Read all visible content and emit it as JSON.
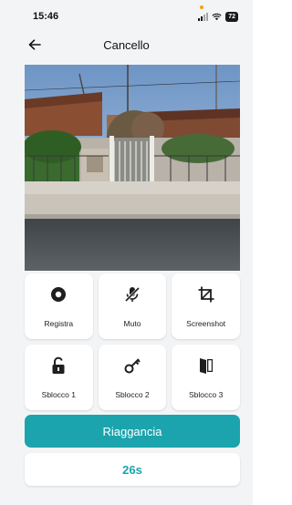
{
  "status_bar": {
    "time": "15:46",
    "battery": "72"
  },
  "nav": {
    "title": "Cancello",
    "back_icon": "arrow-left-icon"
  },
  "video": {
    "description_icon": "camera-feed"
  },
  "actions": [
    {
      "label": "Registra",
      "icon": "record-icon"
    },
    {
      "label": "Muto",
      "icon": "mute-icon"
    },
    {
      "label": "Screenshot",
      "icon": "crop-icon"
    },
    {
      "label": "Sblocco 1",
      "icon": "unlock-icon"
    },
    {
      "label": "Sblocco 2",
      "icon": "key-icon"
    },
    {
      "label": "Sblocco 3",
      "icon": "door-icon"
    }
  ],
  "hangup": {
    "label": "Riaggancia"
  },
  "timer": {
    "value": "26s"
  },
  "colors": {
    "accent": "#1ba4ad",
    "background": "#f3f4f6"
  }
}
